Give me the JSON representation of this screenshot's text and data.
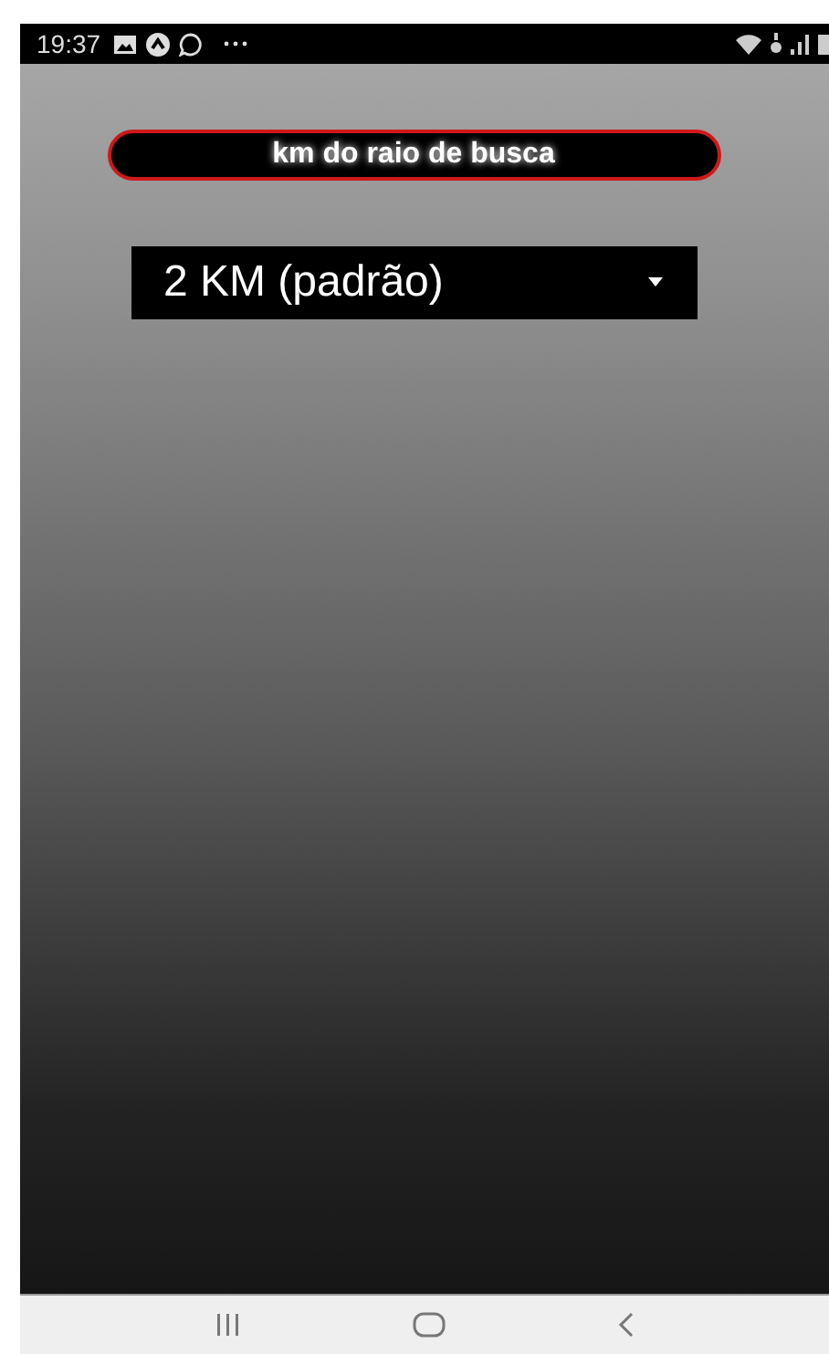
{
  "status_bar": {
    "time": "19:37"
  },
  "header": {
    "label": "km do raio de busca"
  },
  "radius_dropdown": {
    "value": "2 KM (padrão)"
  }
}
